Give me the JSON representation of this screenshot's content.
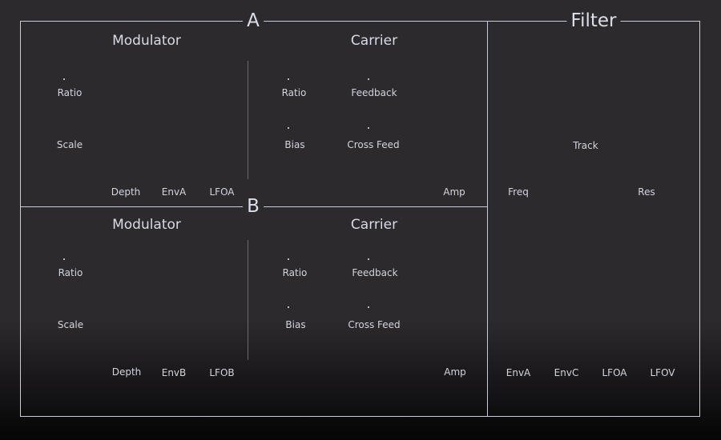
{
  "sections": {
    "a": "A",
    "b": "B",
    "filter": "Filter"
  },
  "a": {
    "modulator": "Modulator",
    "carrier": "Carrier",
    "mod_knobs": [
      "Ratio",
      "Scale"
    ],
    "mod_bottom": [
      "Depth",
      "EnvA",
      "LFOA"
    ],
    "car_knobs": [
      "Ratio",
      "Feedback",
      "Bias",
      "Cross Feed"
    ],
    "amp": "Amp"
  },
  "b": {
    "modulator": "Modulator",
    "carrier": "Carrier",
    "mod_knobs": [
      "Ratio",
      "Scale"
    ],
    "mod_bottom": [
      "Depth",
      "EnvB",
      "LFOB"
    ],
    "car_knobs": [
      "Ratio",
      "Feedback",
      "Bias",
      "Cross Feed"
    ],
    "amp": "Amp"
  },
  "filter": {
    "track": "Track",
    "freq": "Freq",
    "res": "Res",
    "bottom": [
      "EnvA",
      "EnvC",
      "LFOA",
      "LFOV"
    ]
  }
}
